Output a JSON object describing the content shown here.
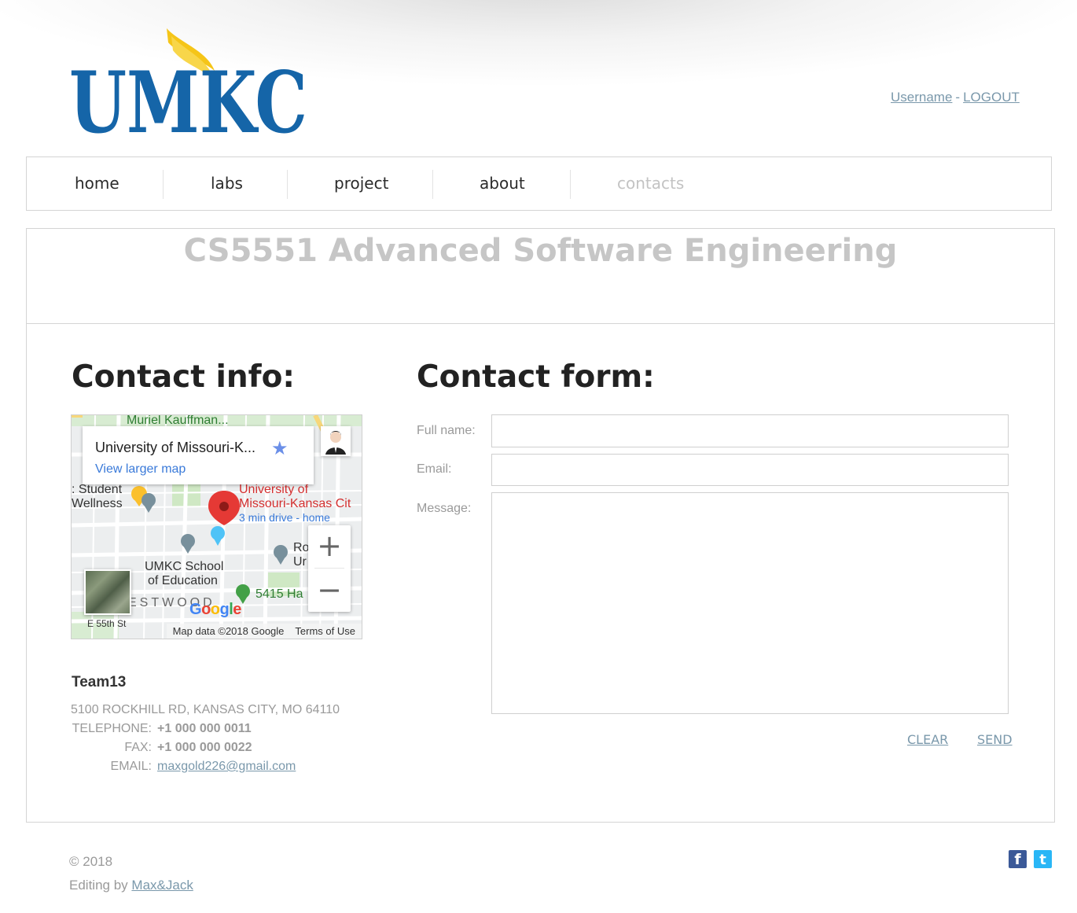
{
  "brand": {
    "logo_text": "UMKC",
    "primary_color": "#1565a8",
    "accent_color": "#f5c518"
  },
  "header": {
    "username": "Username",
    "separator": "-",
    "logout": "LOGOUT"
  },
  "nav": {
    "items": [
      {
        "label": "home"
      },
      {
        "label": "labs"
      },
      {
        "label": "project"
      },
      {
        "label": "about"
      },
      {
        "label": "contacts",
        "active": true
      }
    ]
  },
  "site_title": "CS5551 Advanced Software Engineering",
  "contact_info": {
    "heading": "Contact info:",
    "team": "Team13",
    "address": "5100 ROCKHILL RD, KANSAS CITY, MO 64110",
    "telephone_label": "TELEPHONE:",
    "telephone": "+1 000 000 0011",
    "fax_label": "FAX:",
    "fax": "+1 000 000 0022",
    "email_label": "EMAIL:",
    "email": "maxgold226@gmail.com"
  },
  "map": {
    "place_title": "University of Missouri-K...",
    "view_larger": "View larger map",
    "labels": {
      "muriel": "Muriel Kauffman...",
      "student": ": Student",
      "wellness": "Wellness",
      "univ_1": "University of",
      "univ_2": "Missouri-Kansas Cit",
      "drive": "3 min drive - home",
      "school_1": "UMKC School",
      "school_2": "of Education",
      "addr": "5415 Ha",
      "westwood": "ESTWOOD",
      "street": "E 55th St",
      "ro": "Ro",
      "ur": "Ur"
    },
    "google": "Google",
    "map_data": "Map data ©2018 Google",
    "terms": "Terms of Use",
    "zoom_in": "+",
    "zoom_out": "−"
  },
  "contact_form": {
    "heading": "Contact form:",
    "full_name_label": "Full name:",
    "email_label": "Email:",
    "message_label": "Message:",
    "full_name_value": "",
    "email_value": "",
    "message_value": "",
    "clear": "CLEAR",
    "send": "SEND"
  },
  "footer": {
    "copyright": "© 2018",
    "editing_prefix": "Editing by",
    "editing_link": "Max&Jack",
    "facebook_icon": "f",
    "twitter_icon": "t"
  }
}
